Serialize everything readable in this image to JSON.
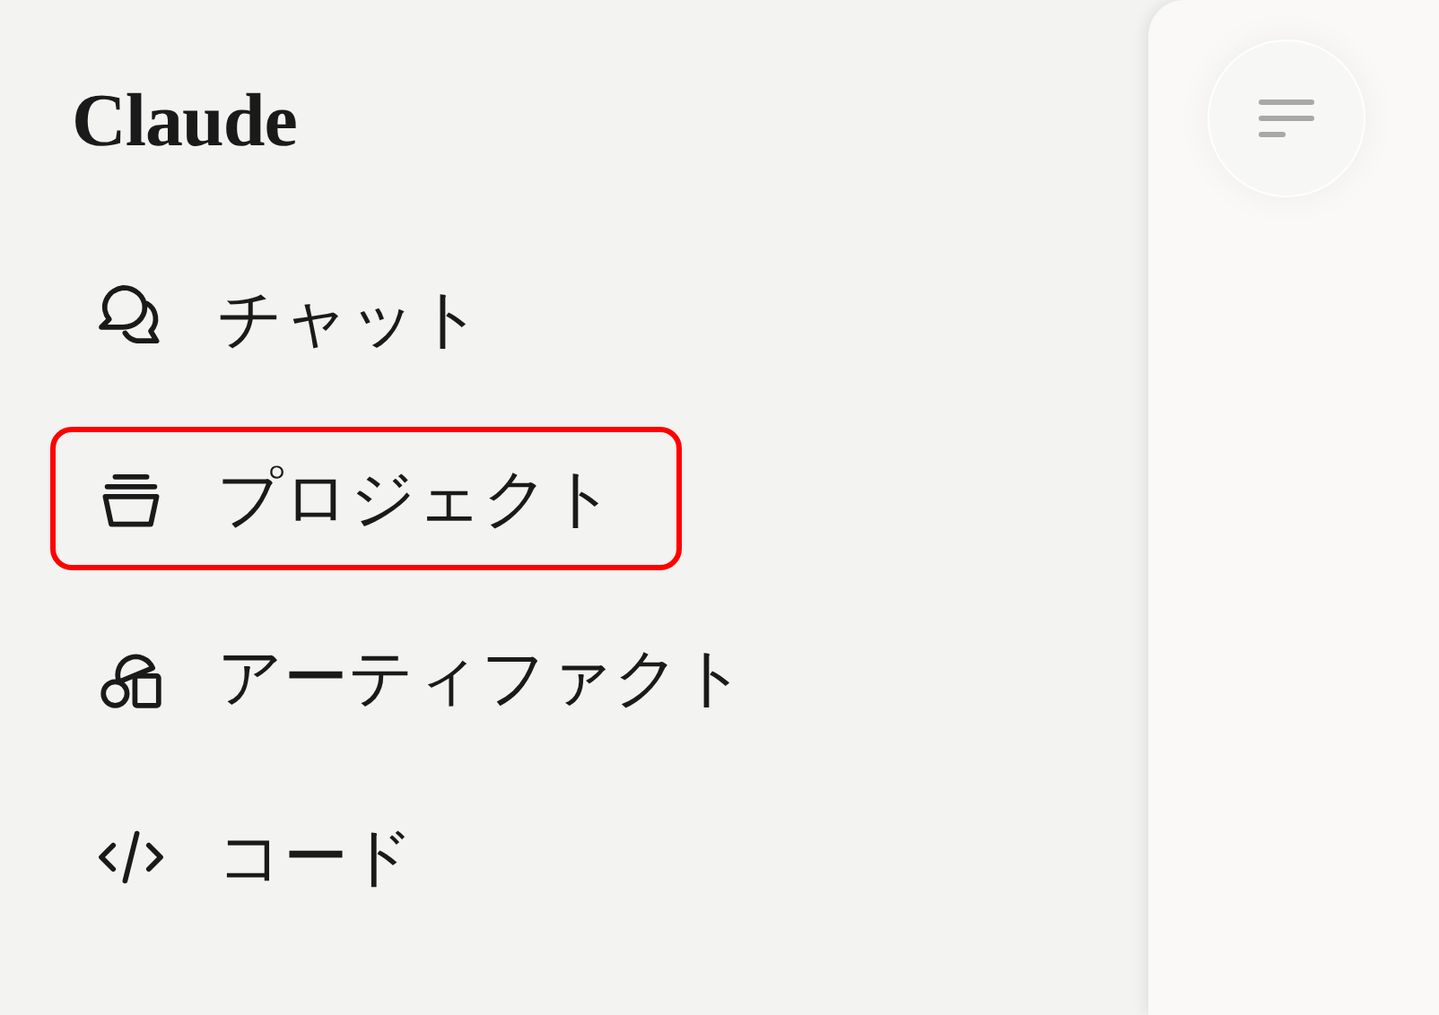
{
  "logo": "Claude",
  "nav_items": [
    {
      "kind": "chat",
      "label": "チャット",
      "highlighted": false
    },
    {
      "kind": "project",
      "label": "プロジェクト",
      "highlighted": true
    },
    {
      "kind": "artifact",
      "label": "アーティファクト",
      "highlighted": false
    },
    {
      "kind": "code",
      "label": "コード",
      "highlighted": false
    }
  ]
}
